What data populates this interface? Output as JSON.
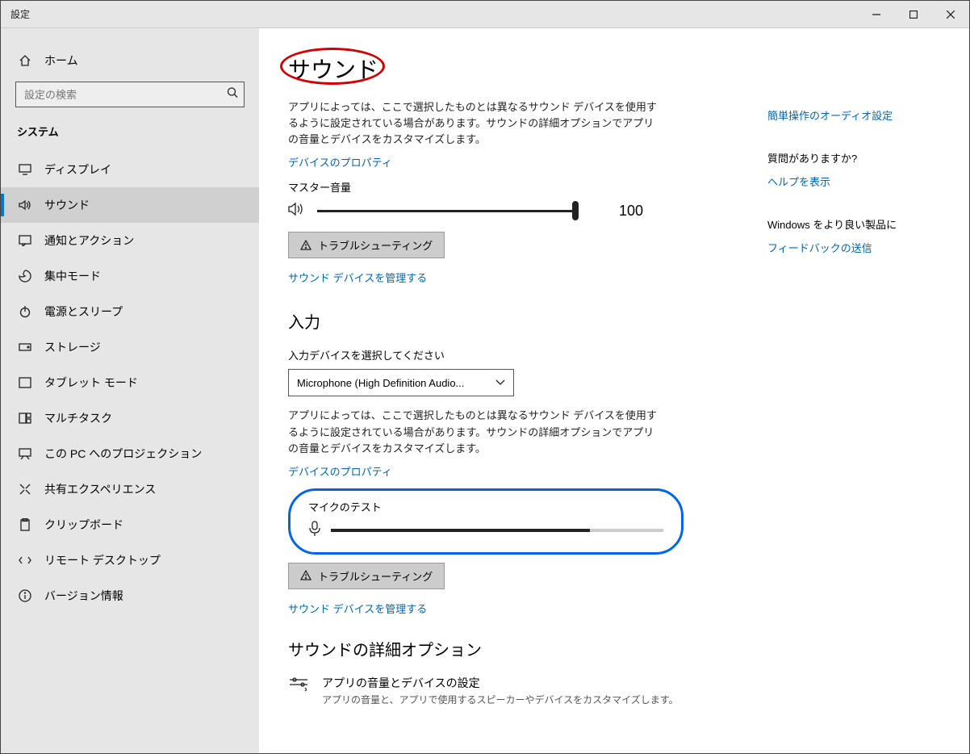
{
  "window": {
    "title": "設定"
  },
  "sidebar": {
    "home": "ホーム",
    "search_placeholder": "設定の検索",
    "category": "システム",
    "items": [
      {
        "label": "ディスプレイ"
      },
      {
        "label": "サウンド"
      },
      {
        "label": "通知とアクション"
      },
      {
        "label": "集中モード"
      },
      {
        "label": "電源とスリープ"
      },
      {
        "label": "ストレージ"
      },
      {
        "label": "タブレット モード"
      },
      {
        "label": "マルチタスク"
      },
      {
        "label": "この PC へのプロジェクション"
      },
      {
        "label": "共有エクスペリエンス"
      },
      {
        "label": "クリップボード"
      },
      {
        "label": "リモート デスクトップ"
      },
      {
        "label": "バージョン情報"
      }
    ]
  },
  "main": {
    "page_title": "サウンド",
    "output_desc": "アプリによっては、ここで選択したものとは異なるサウンド デバイスを使用するように設定されている場合があります。サウンドの詳細オプションでアプリの音量とデバイスをカスタマイズします。",
    "device_props": "デバイスのプロパティ",
    "master_volume": "マスター音量",
    "volume_value": "100",
    "troubleshoot": "トラブルシューティング",
    "manage_devices": "サウンド デバイスを管理する",
    "input_header": "入力",
    "input_select_label": "入力デバイスを選択してください",
    "input_device": "Microphone (High Definition Audio...",
    "input_desc": "アプリによっては、ここで選択したものとは異なるサウンド デバイスを使用するように設定されている場合があります。サウンドの詳細オプションでアプリの音量とデバイスをカスタマイズします。",
    "mic_test": "マイクのテスト",
    "advanced_header": "サウンドの詳細オプション",
    "adv_item_title": "アプリの音量とデバイスの設定",
    "adv_item_sub": "アプリの音量と、アプリで使用するスピーカーやデバイスをカスタマイズします。"
  },
  "right": {
    "easy_access": "簡単操作のオーディオ設定",
    "qa_header": "質問がありますか?",
    "help": "ヘルプを表示",
    "improve_header": "Windows をより良い製品に",
    "feedback": "フィードバックの送信"
  }
}
